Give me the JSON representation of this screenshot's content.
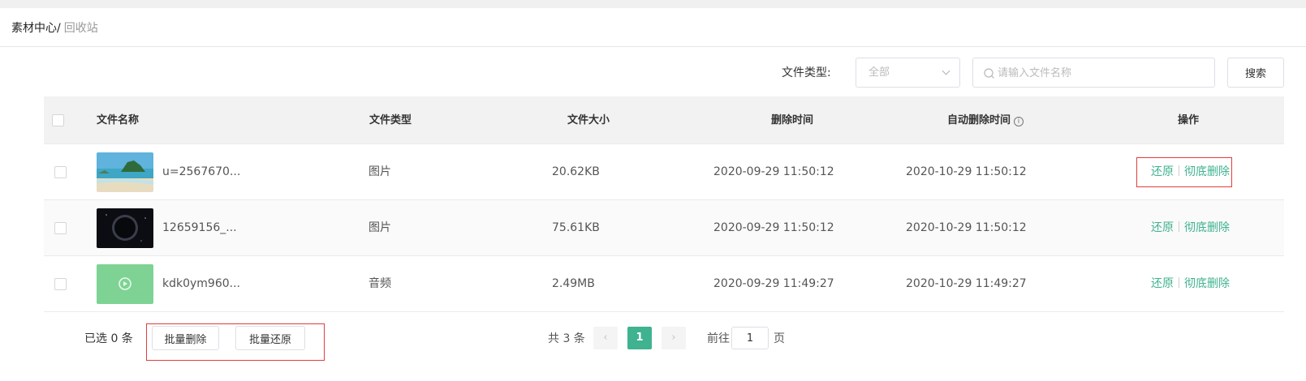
{
  "breadcrumb": {
    "root": "素材中心",
    "separator": "/",
    "current": "回收站"
  },
  "filter": {
    "type_label": "文件类型:",
    "type_selected": "全部",
    "search_placeholder": "请输入文件名称",
    "search_value": "",
    "search_button": "搜索"
  },
  "table": {
    "headers": {
      "name": "文件名称",
      "type": "文件类型",
      "size": "文件大小",
      "deleted_at": "删除时间",
      "auto_delete_at": "自动删除时间",
      "actions": "操作"
    },
    "rows": [
      {
        "name": "u=2567670...",
        "type": "图片",
        "size": "20.62KB",
        "deleted_at": "2020-09-29 11:50:12",
        "auto_delete_at": "2020-10-29 11:50:12",
        "restore": "还原",
        "purge": "彻底删除",
        "thumb": "beach-island-image"
      },
      {
        "name": "12659156_...",
        "type": "图片",
        "size": "75.61KB",
        "deleted_at": "2020-09-29 11:50:12",
        "auto_delete_at": "2020-10-29 11:50:12",
        "restore": "还原",
        "purge": "彻底删除",
        "thumb": "dark-planet-image"
      },
      {
        "name": "kdk0ym960...",
        "type": "音频",
        "size": "2.49MB",
        "deleted_at": "2020-09-29 11:49:27",
        "auto_delete_at": "2020-10-29 11:49:27",
        "restore": "还原",
        "purge": "彻底删除",
        "thumb": "audio-play-icon"
      }
    ]
  },
  "footer": {
    "selected_text": "已选 0 条",
    "batch_delete": "批量删除",
    "batch_restore": "批量还原",
    "total_text": "共 3 条",
    "current_page": "1",
    "goto_label": "前往",
    "goto_value": "1",
    "goto_suffix": "页"
  },
  "colors": {
    "accent": "#3fb28f",
    "highlight": "#e23c3c"
  }
}
